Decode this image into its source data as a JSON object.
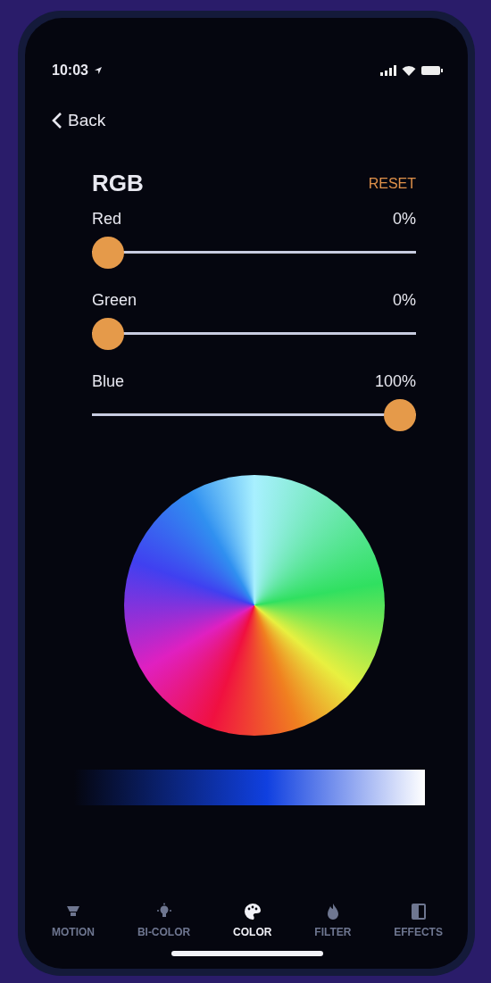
{
  "status_bar": {
    "time": "10:03"
  },
  "nav": {
    "back": "Back"
  },
  "section": {
    "title": "RGB",
    "reset": "RESET"
  },
  "sliders": [
    {
      "name": "Red",
      "reading": "0%",
      "level": 0
    },
    {
      "name": "Green",
      "reading": "0%",
      "level": 0
    },
    {
      "name": "Blue",
      "reading": "100%",
      "level": 1
    }
  ],
  "tabs": [
    {
      "label": "MOTION",
      "selected": false
    },
    {
      "label": "BI-COLOR",
      "selected": false
    },
    {
      "label": "COLOR",
      "selected": true
    },
    {
      "label": "FILTER",
      "selected": false
    },
    {
      "label": "EFFECTS",
      "selected": false
    }
  ]
}
